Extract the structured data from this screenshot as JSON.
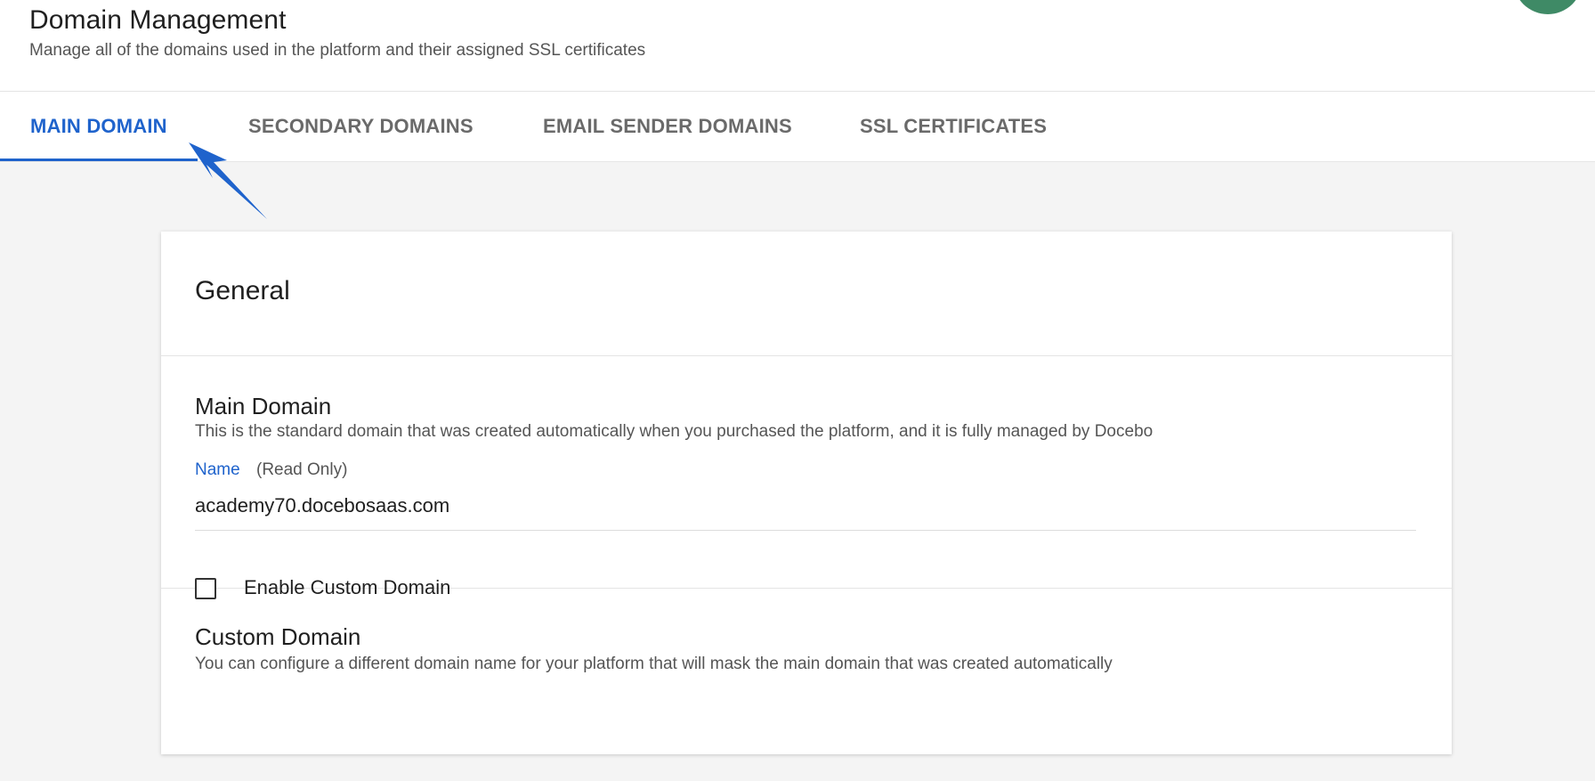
{
  "header": {
    "title": "Domain Management",
    "subtitle": "Manage all of the domains used in the platform and their assigned SSL certificates"
  },
  "tabs": [
    {
      "label": "MAIN DOMAIN",
      "active": true
    },
    {
      "label": "SECONDARY DOMAINS",
      "active": false
    },
    {
      "label": "EMAIL SENDER DOMAINS",
      "active": false
    },
    {
      "label": "SSL CERTIFICATES",
      "active": false
    }
  ],
  "card": {
    "general_title": "General",
    "main_domain": {
      "title": "Main Domain",
      "description": "This is the standard domain that was created automatically when you purchased the platform, and it is fully managed by Docebo",
      "field_label": "Name",
      "field_hint": "(Read Only)",
      "field_value": "academy70.docebosaas.com"
    },
    "custom_domain": {
      "title": "Custom Domain",
      "description": "You can configure a different domain name for your platform that will mask the main domain that was created automatically",
      "checkbox_label": "Enable Custom Domain",
      "checkbox_checked": false
    }
  },
  "colors": {
    "accent": "#1f63cc",
    "avatar": "#3f8a66",
    "background": "#f4f4f4",
    "annotation_arrow": "#1f63cc"
  },
  "icons": {
    "annotation": "arrow-pointer-icon",
    "checkbox": "checkbox-unchecked-icon"
  }
}
